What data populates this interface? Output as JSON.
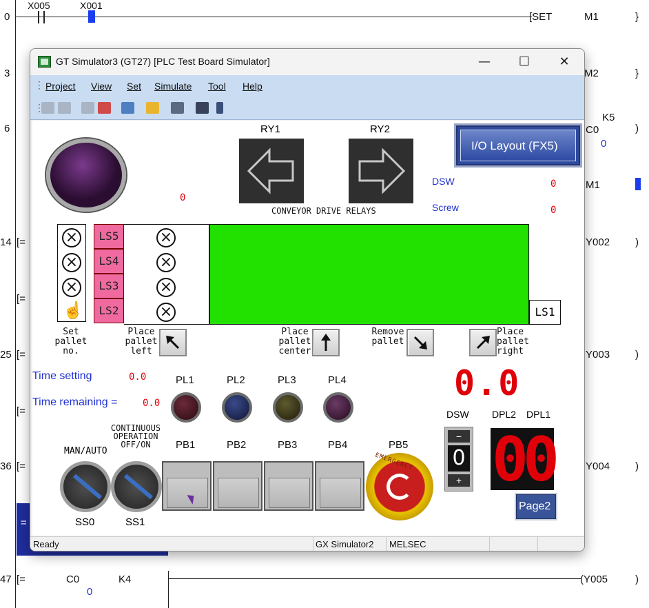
{
  "ladder": {
    "row0_step": "0",
    "row0_contact1": "X005",
    "row0_contact2": "X001",
    "row0_cmd": "[SET",
    "row0_dev": "M1",
    "row1_step": "3",
    "row1_dev": "M2",
    "row2_step": "6",
    "row2_k": "K5",
    "row2_dev": "C0",
    "row2_val": "0",
    "row3_dev": "M1",
    "row4_step": "14",
    "row4_bracket": "[=",
    "row4_dev": "Y002",
    "row5_bracket": "[=",
    "row6_step": "25",
    "row6_bracket": "[=",
    "row6_dev": "Y003",
    "row7_bracket": "[=",
    "row8_step": "36",
    "row8_bracket": "[=",
    "row8_dev": "Y004",
    "row9_bracket": "=",
    "row10_step": "47",
    "row10_bracket": "[=",
    "row10_c": "C0",
    "row10_k": "K4",
    "row10_val": "0",
    "row10_dev": "(Y005"
  },
  "window": {
    "title": "GT Simulator3 (GT27)  [PLC Test Board Simulator]",
    "minimize": "—",
    "maximize": "☐",
    "close": "✕"
  },
  "menu": [
    {
      "label": "Project"
    },
    {
      "label": "View"
    },
    {
      "label": "Set"
    },
    {
      "label": "Simulate"
    },
    {
      "label": "Tool"
    },
    {
      "label": "Help"
    }
  ],
  "board": {
    "ry1": "RY1",
    "ry2": "RY2",
    "io_layout": "I/O Layout (FX5)",
    "dsw_label": "DSW",
    "dsw_value": "0",
    "screw_label": "Screw",
    "screw_value": "0",
    "counter_value": "0",
    "conveyor_label": "CONVEYOR DRIVE RELAYS",
    "ls5": "LS5",
    "ls4": "LS4",
    "ls3": "LS3",
    "ls2": "LS2",
    "ls1": "LS1",
    "set_pallet": "Set\npallet\nno.",
    "place_left": "Place\npallet\nleft",
    "place_center": "Place\npallet\ncenter",
    "remove_pallet": "Remove\npallet",
    "place_right": "Place\npallet\nright",
    "time_setting_label": "Time setting",
    "time_setting_value": "0.0",
    "time_remaining_label": "Time remaining =",
    "time_remaining_value": "0.0",
    "pl1": "PL1",
    "pl2": "PL2",
    "pl3": "PL3",
    "pl4": "PL4",
    "big_display": "0.0",
    "dsw2_label": "DSW",
    "dpl2_label": "DPL2",
    "dpl1_label": "DPL1",
    "dsw_digit": "0",
    "dsw_minus": "−",
    "dsw_plus": "+",
    "seg_display": "00",
    "continuous_label": "CONTINUOUS\nOPERATION\nOFF/ON",
    "man_auto_label": "MAN/AUTO",
    "pb1": "PB1",
    "pb2": "PB2",
    "pb3": "PB3",
    "pb4": "PB4",
    "pb5": "PB5",
    "emergency": "EMERGENCY",
    "ss0": "SS0",
    "ss1": "SS1",
    "page2": "Page2"
  },
  "status": {
    "ready": "Ready",
    "sim": "GX Simulator2",
    "melsec": "MELSEC"
  }
}
